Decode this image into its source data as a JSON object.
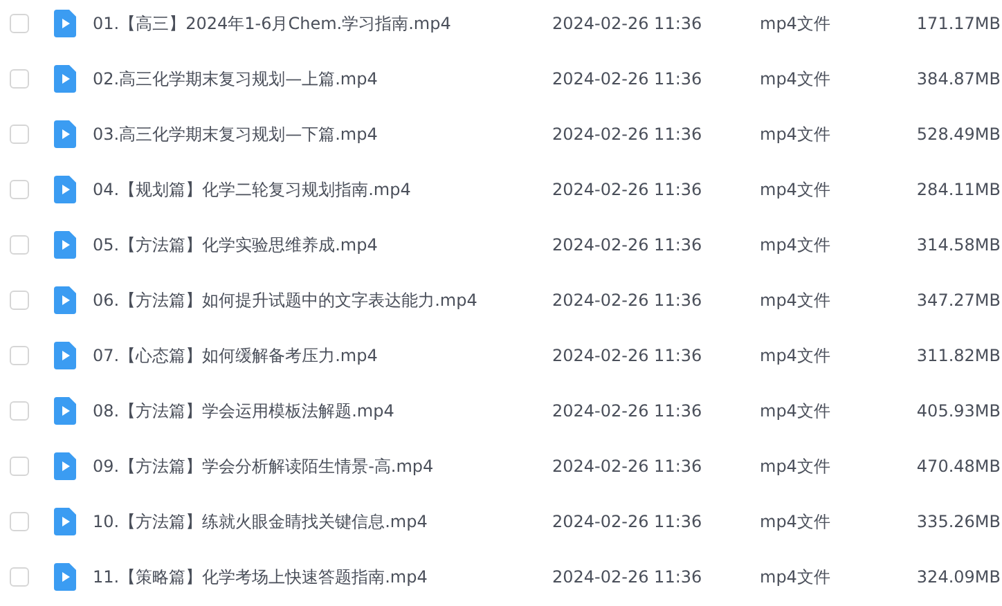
{
  "files": [
    {
      "checked": false,
      "name": "01.【高三】2024年1-6月Chem.学习指南.mp4",
      "modified": "2024-02-26 11:36",
      "type": "mp4文件",
      "size": "171.17MB"
    },
    {
      "checked": false,
      "name": "02.高三化学期末复习规划—上篇.mp4",
      "modified": "2024-02-26 11:36",
      "type": "mp4文件",
      "size": "384.87MB"
    },
    {
      "checked": false,
      "name": "03.高三化学期末复习规划—下篇.mp4",
      "modified": "2024-02-26 11:36",
      "type": "mp4文件",
      "size": "528.49MB"
    },
    {
      "checked": false,
      "name": "04.【规划篇】化学二轮复习规划指南.mp4",
      "modified": "2024-02-26 11:36",
      "type": "mp4文件",
      "size": "284.11MB"
    },
    {
      "checked": false,
      "name": "05.【方法篇】化学实验思维养成.mp4",
      "modified": "2024-02-26 11:36",
      "type": "mp4文件",
      "size": "314.58MB"
    },
    {
      "checked": false,
      "name": "06.【方法篇】如何提升试题中的文字表达能力.mp4",
      "modified": "2024-02-26 11:36",
      "type": "mp4文件",
      "size": "347.27MB"
    },
    {
      "checked": false,
      "name": "07.【心态篇】如何缓解备考压力.mp4",
      "modified": "2024-02-26 11:36",
      "type": "mp4文件",
      "size": "311.82MB"
    },
    {
      "checked": false,
      "name": "08.【方法篇】学会运用模板法解题.mp4",
      "modified": "2024-02-26 11:36",
      "type": "mp4文件",
      "size": "405.93MB"
    },
    {
      "checked": false,
      "name": "09.【方法篇】学会分析解读陌生情景-高.mp4",
      "modified": "2024-02-26 11:36",
      "type": "mp4文件",
      "size": "470.48MB"
    },
    {
      "checked": false,
      "name": "10.【方法篇】练就火眼金睛找关键信息.mp4",
      "modified": "2024-02-26 11:36",
      "type": "mp4文件",
      "size": "335.26MB"
    },
    {
      "checked": false,
      "name": "11.【策略篇】化学考场上快速答题指南.mp4",
      "modified": "2024-02-26 11:36",
      "type": "mp4文件",
      "size": "324.09MB"
    }
  ]
}
